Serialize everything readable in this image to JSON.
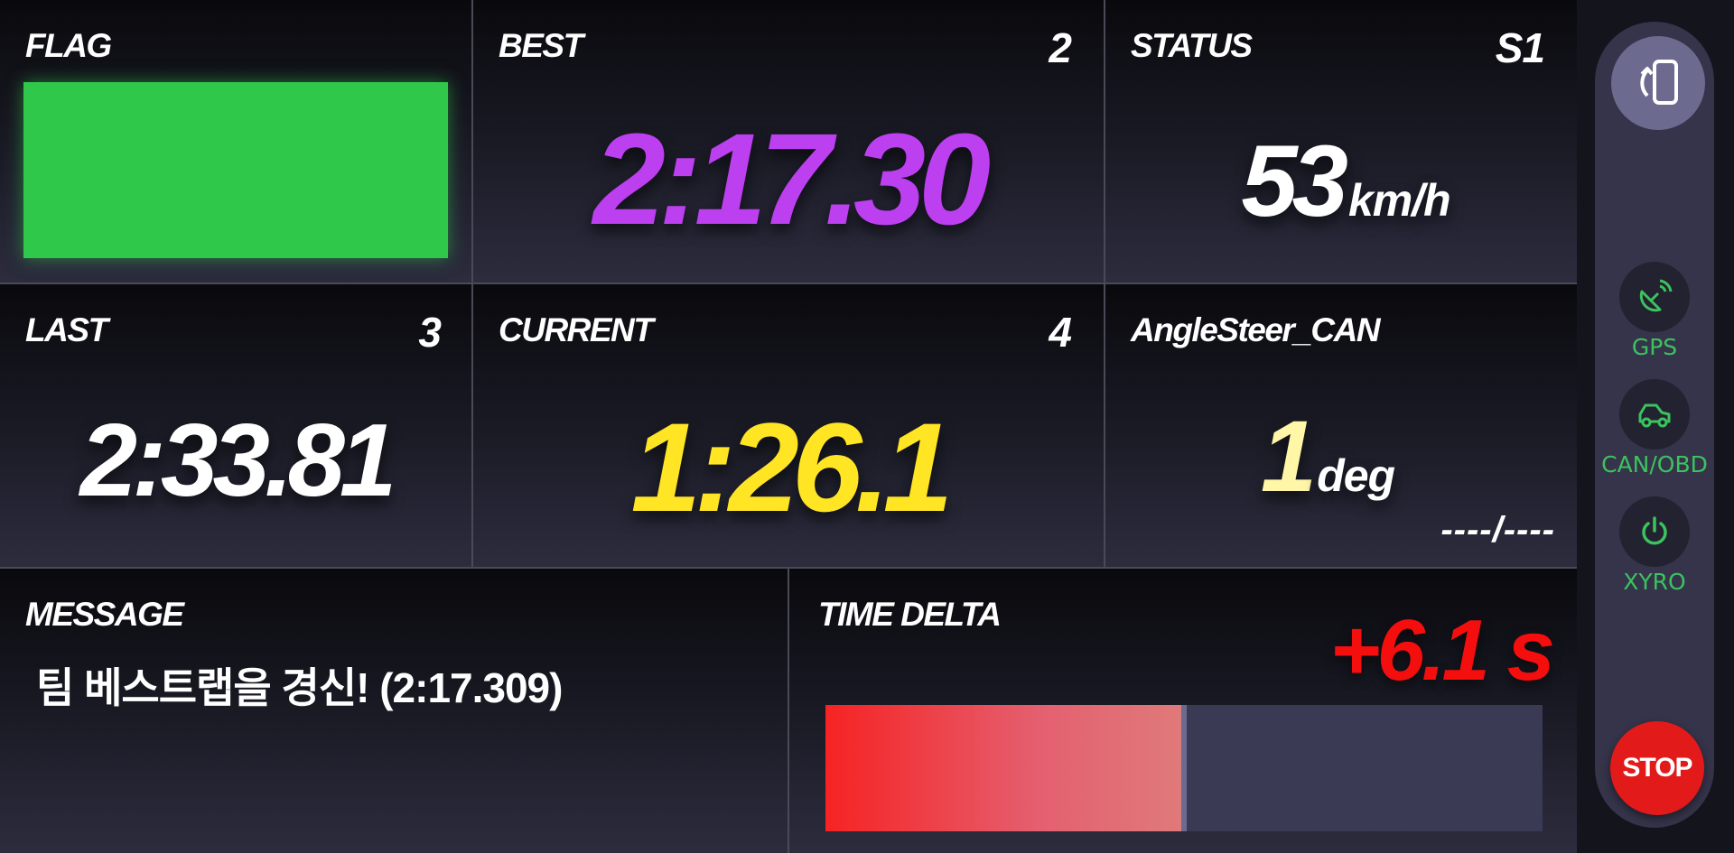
{
  "panels": {
    "flag": {
      "label": "FLAG",
      "color": "#2fc84a"
    },
    "best": {
      "label": "BEST",
      "lap": "2",
      "time": "2:17.30",
      "color": "#bc3ff0"
    },
    "status": {
      "label": "STATUS",
      "sector": "S1",
      "speed": "53",
      "unit": "km/h"
    },
    "last": {
      "label": "LAST",
      "lap": "3",
      "time": "2:33.81"
    },
    "current": {
      "label": "CURRENT",
      "lap": "4",
      "time": "1:26.1",
      "color": "#ffe524"
    },
    "angle": {
      "label": "AngleSteer_CAN",
      "value": "1",
      "unit": "deg",
      "extra": "----/----",
      "value_color": "#fff6a8"
    },
    "message": {
      "label": "MESSAGE",
      "text": "팀 베스트랩을 경신! (2:17.309)"
    },
    "delta": {
      "label": "TIME DELTA",
      "value": "+6.1 s",
      "fill_fraction": 0.5,
      "color": "#f50e0e"
    }
  },
  "sidebar": {
    "rotate_icon": "screen-rotation-icon",
    "items": [
      {
        "label": "GPS",
        "icon": "satellite-dish-icon"
      },
      {
        "label": "CAN/OBD",
        "icon": "car-icon"
      },
      {
        "label": "XYRO",
        "icon": "power-icon"
      }
    ],
    "status_color": "#3cc25e",
    "stop_label": "STOP"
  }
}
